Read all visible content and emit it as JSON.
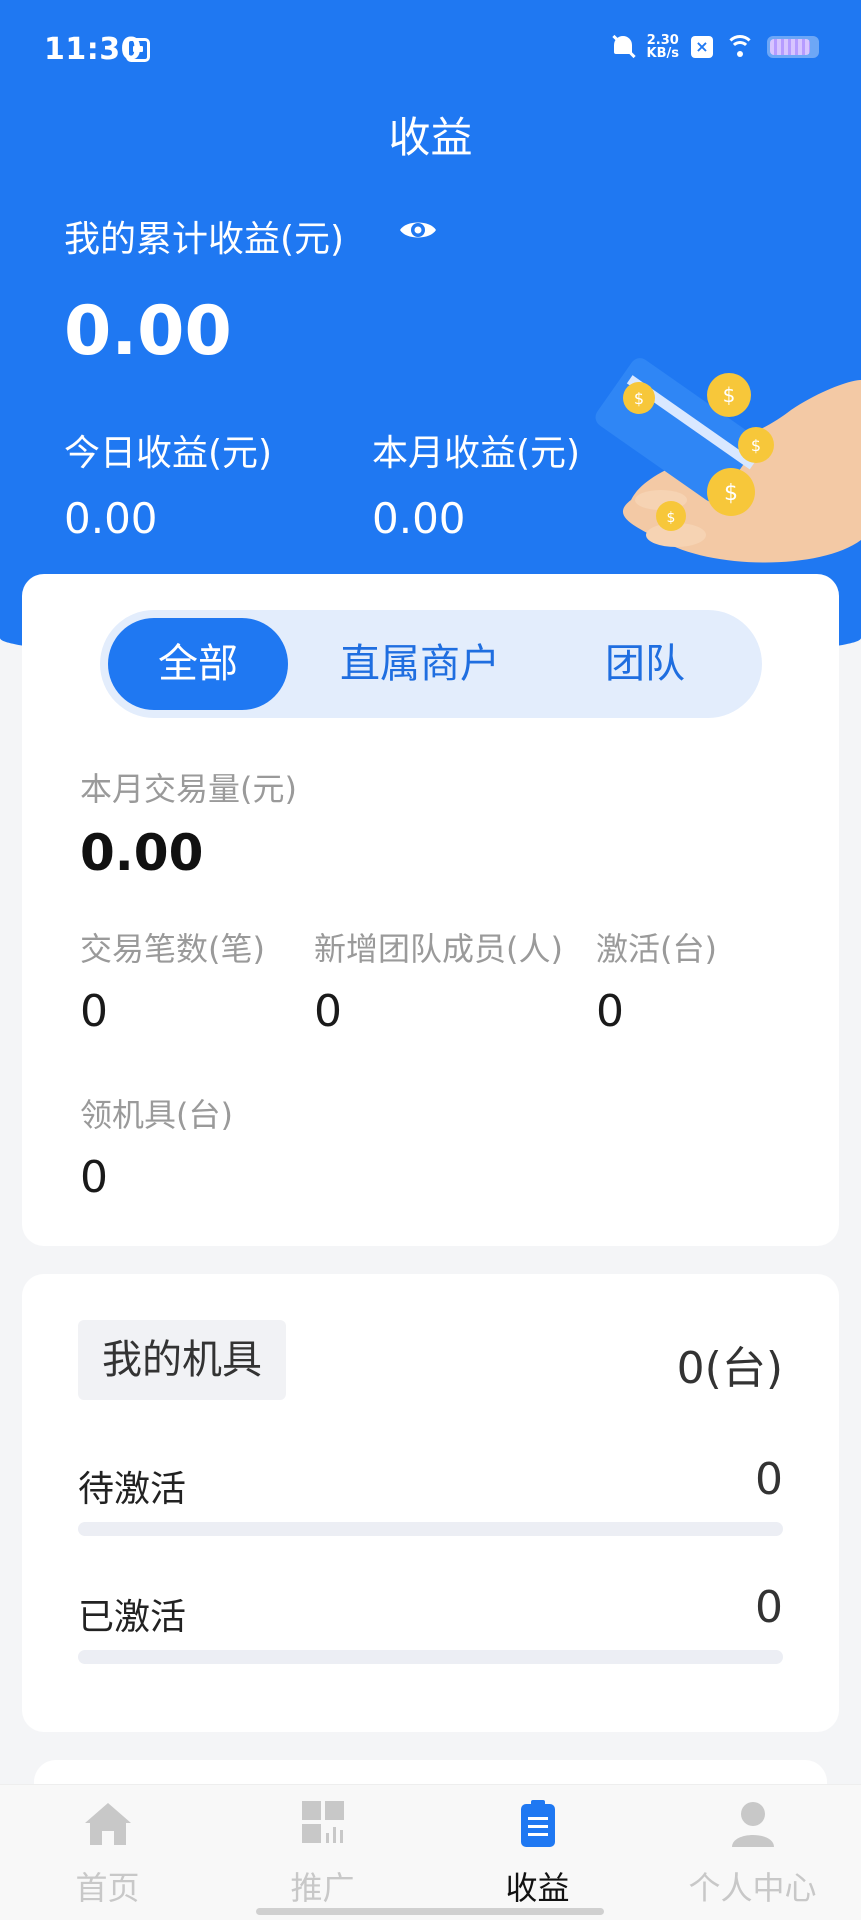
{
  "status_bar": {
    "time": "11:30",
    "net_speed_value": "2.30",
    "net_speed_unit": "KB/s"
  },
  "header": {
    "title": "收益"
  },
  "earnings": {
    "cumulative_label": "我的累计收益(元)",
    "cumulative_value": "0.00",
    "today_label": "今日收益(元)",
    "today_value": "0.00",
    "month_label": "本月收益(元)",
    "month_value": "0.00"
  },
  "segments": [
    "全部",
    "直属商户",
    "团队"
  ],
  "segments_active_index": 0,
  "stats": {
    "monthly_volume_label": "本月交易量(元)",
    "monthly_volume_value": "0.00",
    "transactions_label": "交易笔数(笔)",
    "transactions_value": "0",
    "new_members_label": "新增团队成员(人)",
    "new_members_value": "0",
    "activation_label": "激活(台)",
    "activation_value": "0",
    "received_label": "领机具(台)",
    "received_value": "0"
  },
  "machines": {
    "title": "我的机具",
    "total": "0(台)",
    "pending_label": "待激活",
    "pending_value": "0",
    "pending_progress": 0,
    "activated_label": "已激活",
    "activated_value": "0",
    "activated_progress": 0
  },
  "tabbar": [
    {
      "label": "首页",
      "icon": "home-icon"
    },
    {
      "label": "推广",
      "icon": "qr-grid-icon"
    },
    {
      "label": "收益",
      "icon": "clipboard-icon"
    },
    {
      "label": "个人中心",
      "icon": "person-icon"
    }
  ],
  "tabbar_active_index": 2,
  "colors": {
    "primary": "#1f78f2",
    "segment_bg": "#e3edfc",
    "muted_text": "#9a9a9a",
    "inactive_tab": "#c8c8c8"
  }
}
